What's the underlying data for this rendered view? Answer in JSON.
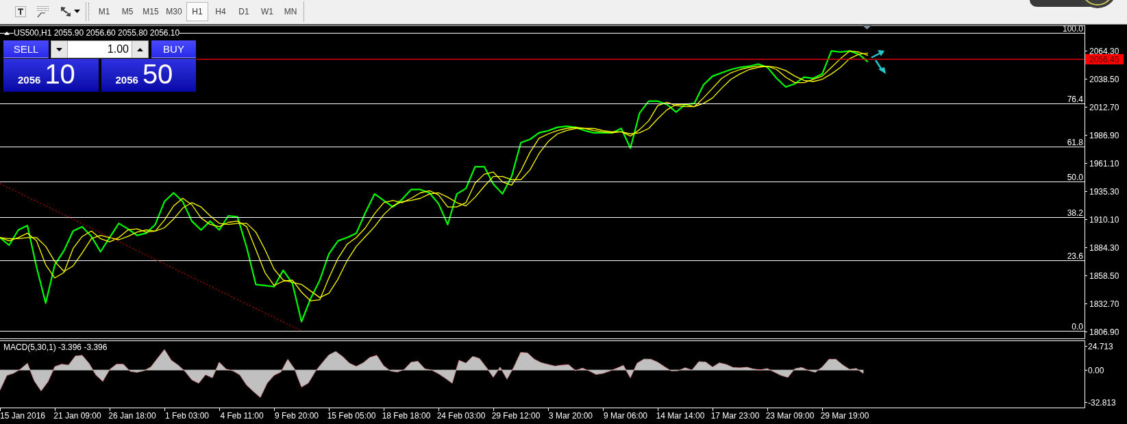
{
  "toolbar": {
    "timeframes": [
      {
        "label": "M1",
        "selected": false
      },
      {
        "label": "M5",
        "selected": false
      },
      {
        "label": "M15",
        "selected": false
      },
      {
        "label": "M30",
        "selected": false
      },
      {
        "label": "H1",
        "selected": true
      },
      {
        "label": "H4",
        "selected": false
      },
      {
        "label": "D1",
        "selected": false
      },
      {
        "label": "W1",
        "selected": false
      },
      {
        "label": "MN",
        "selected": false
      }
    ]
  },
  "chart": {
    "fibonacci_levels": [
      "100.0",
      "76.4",
      "61.8",
      "50.0",
      "38.2",
      "23.6",
      "0.0"
    ],
    "bid_price": "2056.45",
    "chart_data": {
      "type": "line",
      "title": "US500,H1 2055.90 2056.60 2055.80 2056.10",
      "series": [
        {
          "color": "#00ff00",
          "values": [
            1893,
            1886,
            1900,
            1904,
            1866,
            1833,
            1868,
            1881,
            1899,
            1903,
            1894,
            1880,
            1893,
            1906,
            1901,
            1895,
            1897,
            1905,
            1926,
            1934,
            1926,
            1908,
            1900,
            1908,
            1900,
            1913,
            1912,
            1884,
            1850,
            1849,
            1848,
            1863,
            1851,
            1816,
            1837,
            1854,
            1878,
            1890,
            1893,
            1897,
            1916,
            1933,
            1927,
            1921,
            1928,
            1937,
            1937,
            1934,
            1924,
            1905,
            1933,
            1938,
            1958,
            1958,
            1942,
            1933,
            1949,
            1980,
            1983,
            1989,
            1991,
            1994,
            1995,
            1994,
            1991,
            1989,
            1989,
            1989,
            1993,
            1975,
            2007,
            2018,
            2018,
            2015,
            2008,
            2015,
            2016,
            2033,
            2041,
            2044,
            2047,
            2049,
            2050,
            2052,
            2049,
            2039,
            2031,
            2034,
            2040,
            2039,
            2043,
            2064,
            2063,
            2064,
            2061,
            2054
          ]
        },
        {
          "color": "#ffff00",
          "values": [
            1893,
            1890,
            1893,
            1897,
            1890,
            1868,
            1856,
            1861,
            1883,
            1894,
            1899,
            1892,
            1889,
            1893,
            1900,
            1901,
            1898,
            1899,
            1909,
            1922,
            1929,
            1923,
            1911,
            1905,
            1903,
            1907,
            1908,
            1903,
            1882,
            1861,
            1849,
            1853,
            1854,
            1843,
            1835,
            1836,
            1856,
            1874,
            1887,
            1893,
            1902,
            1915,
            1925,
            1927,
            1925,
            1929,
            1934,
            1936,
            1932,
            1921,
            1921,
            1925,
            1943,
            1951,
            1953,
            1944,
            1941,
            1954,
            1971,
            1984,
            1988,
            1991,
            1993,
            1994,
            1993,
            1991,
            1990,
            1989,
            1990,
            1986,
            1992,
            2000,
            2014,
            2017,
            2014,
            2013,
            2013,
            2021,
            2030,
            2039,
            2044,
            2047,
            2049,
            2050,
            2050,
            2047,
            2040,
            2035,
            2035,
            2038,
            2041,
            2049,
            2057,
            2064,
            2063,
            2060
          ]
        },
        {
          "color": "#ffff00",
          "values": [
            1893,
            1892,
            1892,
            1893,
            1893,
            1885,
            1871,
            1862,
            1867,
            1879,
            1892,
            1895,
            1893,
            1891,
            1894,
            1898,
            1900,
            1899,
            1902,
            1910,
            1920,
            1925,
            1921,
            1913,
            1906,
            1905,
            1906,
            1906,
            1898,
            1882,
            1864,
            1854,
            1852,
            1850,
            1844,
            1838,
            1842,
            1855,
            1872,
            1885,
            1894,
            1903,
            1914,
            1922,
            1926,
            1927,
            1929,
            1933,
            1934,
            1930,
            1925,
            1922,
            1930,
            1940,
            1949,
            1949,
            1946,
            1946,
            1955,
            1970,
            1981,
            1988,
            1991,
            1993,
            1993,
            1993,
            1991,
            1990,
            1990,
            1988,
            1989,
            1993,
            2002,
            2010,
            2015,
            2015,
            2013,
            2016,
            2021,
            2030,
            2038,
            2043,
            2047,
            2049,
            2050,
            2049,
            2046,
            2041,
            2037,
            2036,
            2038,
            2043,
            2049,
            2057,
            2061,
            2062
          ]
        }
      ],
      "ylim": [
        1800.6,
        2087.5
      ],
      "yticks": [
        {
          "value": 2064.3,
          "label": "2064.30"
        },
        {
          "value": 2038.5,
          "label": "2038.50"
        },
        {
          "value": 2012.7,
          "label": "2012.70"
        },
        {
          "value": 1986.9,
          "label": "1986.90"
        },
        {
          "value": 1961.1,
          "label": "1961.10"
        },
        {
          "value": 1935.3,
          "label": "1935.30"
        },
        {
          "value": 1910.1,
          "label": "1910.10"
        },
        {
          "value": 1884.3,
          "label": "1884.30"
        },
        {
          "value": 1858.5,
          "label": "1858.50"
        },
        {
          "value": 1832.7,
          "label": "1832.70"
        },
        {
          "value": 1806.9,
          "label": "1806.90"
        }
      ]
    }
  },
  "trade_panel": {
    "sell": {
      "label": "SELL",
      "price_prefix": "2056",
      "price_main": "10"
    },
    "lots": {
      "value": "1.00"
    },
    "buy": {
      "label": "BUY",
      "price_prefix": "2056",
      "price_main": "50"
    }
  },
  "indicator": {
    "chart_data": {
      "type": "area",
      "title": "MACD(5,30,1) -3.396 -3.396",
      "categories": [
        null,
        null,
        null,
        "15 Jan 2016",
        null,
        null,
        null,
        null,
        null,
        null,
        null,
        "21 Jan 09:00",
        null,
        null,
        null,
        null,
        null,
        null,
        null,
        "26 Jan 18:00",
        null,
        null,
        null,
        null,
        null,
        null,
        null,
        "1 Feb 03:00",
        null,
        null,
        null,
        null,
        null,
        null,
        null,
        "4 Feb 11:00",
        null,
        null,
        null,
        null,
        null,
        null,
        null,
        "9 Feb 20:00",
        null,
        null,
        null,
        null,
        null,
        null,
        null,
        "15 Feb 05:00",
        null,
        null,
        null,
        null,
        null,
        null,
        null,
        "18 Feb 18:00",
        null,
        null,
        null,
        null,
        null,
        null,
        null,
        "24 Feb 03:00",
        null,
        null,
        null,
        null,
        null,
        null,
        null,
        "29 Feb 12:00",
        null,
        null,
        null,
        null,
        null,
        null,
        null,
        "3 Mar 20:00",
        null,
        null,
        null,
        null,
        null,
        null,
        null,
        "9 Mar 06:00",
        null,
        null,
        null,
        null,
        null,
        null,
        null,
        "14 Mar 14:00",
        null,
        null,
        null,
        null,
        null,
        null,
        null,
        "17 Mar 23:00",
        null,
        null,
        null,
        null,
        null,
        null,
        null,
        "23 Mar 09:00",
        null,
        null,
        null,
        null,
        null,
        null,
        null,
        "29 Mar 19:00",
        null,
        null,
        null
      ],
      "series": [
        {
          "color": "#c0c0c0",
          "values": [
            -20.5,
            -5.5,
            -3.2,
            1,
            7,
            -11,
            -21.4,
            -12,
            3.5,
            6,
            5,
            14.3,
            15,
            6.8,
            -5,
            -11.6,
            0.5,
            6,
            6,
            -1.3,
            -2.3,
            -0.7,
            3,
            12,
            21,
            10,
            5,
            -1.3,
            -10,
            -13.5,
            -4.7,
            -8,
            8,
            1,
            -0.8,
            -4.9,
            -15.5,
            -22,
            -28,
            -13.3,
            -5.4,
            -2,
            11,
            1,
            -17.4,
            -13.4,
            -1.7,
            7,
            15.4,
            19,
            13.8,
            7,
            3.7,
            7.3,
            13,
            15,
            4.3,
            -1,
            -2,
            0.5,
            8,
            9,
            1.3,
            0,
            -3.7,
            -8.3,
            -13.5,
            10,
            7,
            14,
            11.7,
            2.6,
            -7.4,
            3,
            -9.3,
            3,
            18,
            17.5,
            11,
            7.5,
            5.7,
            4,
            5,
            5.5,
            -0.6,
            2,
            -0.8,
            -4.5,
            -3.4,
            -1,
            1.8,
            4.8,
            -8,
            7,
            11.2,
            11,
            8,
            3.3,
            -1,
            -0.6,
            2.3,
            0,
            8.6,
            8.2,
            3,
            7.4,
            5.7,
            2.6,
            2.2,
            2.9,
            1,
            0.3,
            1.5,
            -2,
            -5.4,
            -7.5,
            1.3,
            2.6,
            -0.3,
            -2.2,
            3,
            11,
            11,
            5.3,
            0.7,
            1.6,
            -3.4
          ]
        }
      ],
      "ylim": [
        -38.4,
        30.3
      ],
      "yticks": [
        {
          "value": 24.713,
          "label": "24.713"
        },
        {
          "value": 0,
          "label": "0.00"
        },
        {
          "value": -32.813,
          "label": "-32.813"
        }
      ]
    }
  }
}
